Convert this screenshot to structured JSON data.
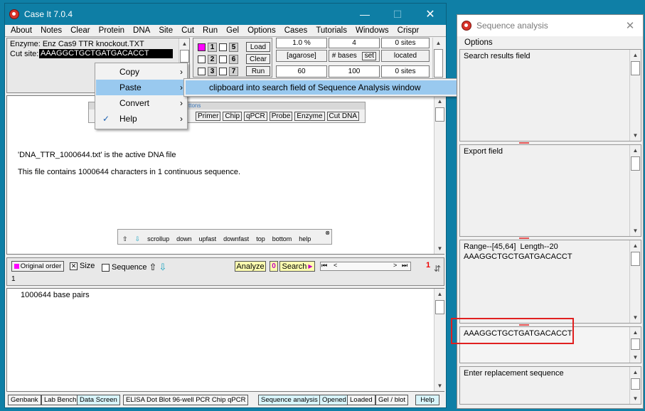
{
  "main_window": {
    "title": "Case It 7.0.4",
    "menu": [
      "About",
      "Notes",
      "Clear",
      "Protein",
      "DNA",
      "Site",
      "Cut",
      "Run",
      "Gel",
      "Options",
      "Cases",
      "Tutorials",
      "Windows",
      "Crispr"
    ],
    "enzyme_label": "Enzyme: Enz Cas9 TTR knockout.TXT",
    "cut_site_label": "Cut site:",
    "cut_site_value": "AAAGGCTGCTGATGACACCT",
    "slots": [
      "1",
      "5",
      "2",
      "6",
      "3",
      "7"
    ],
    "load_label": "Load",
    "clear_label": "Clear",
    "run_label": "Run",
    "agarose_pct": "1.0  %",
    "agarose_label": "[agarose]",
    "val_60": "60",
    "bases_value": "4",
    "bases_label": "# bases",
    "set_label": "set",
    "val_100": "100",
    "sites_top": "0  sites",
    "located_label": "located",
    "sites_bottom": "0  sites",
    "toolbar_buttons": [
      "Primer",
      "Chip",
      "qPCR",
      "Probe",
      "Enzyme",
      "Cut DNA"
    ],
    "toolbar_tail": "ttons",
    "content_line1": "'DNA_TTR_1000644.txt' is the active DNA file",
    "content_line2": "This file contains 1000644 characters in 1 continuous sequence.",
    "scroll_nav": [
      "scrollup",
      "down",
      "upfast",
      "downfast",
      "top",
      "bottom",
      "help"
    ],
    "original_order": "Original order",
    "size_label": "Size",
    "sequence_label": "Sequence",
    "analyze_label": "Analyze",
    "search_count": "0",
    "search_label": "Search",
    "position_indicator": "1",
    "row_number": "1",
    "base_pairs": "1000644 base pairs",
    "bottom_tabs": [
      "Genbank",
      "Lab Bench",
      "Data Screen",
      "ELISA  Dot Blot   96-well PCR   Chip  qPCR",
      "Sequence analysis",
      "Opened",
      "Loaded",
      "Gel / blot",
      "Help"
    ]
  },
  "context_menu": {
    "items": [
      "Copy",
      "Paste",
      "Convert",
      "Help"
    ],
    "submenu_item": "clipboard into search field of Sequence Analysis window"
  },
  "seq_window": {
    "title": "Sequence analysis",
    "menu": "Options",
    "search_results": "Search results field",
    "export_field": "Export field",
    "range_line1": "Range--[45,64]  Length--20",
    "range_line2": "AAAGGCTGCTGATGACACCT",
    "search_field_value": "AAAGGCTGCTGATGACACCT",
    "replacement_label": "Enter replacement sequence"
  },
  "colors": {
    "desktop": "#0f7fa6",
    "title_active": "#0e7ea5",
    "highlight": "#99c9ef",
    "red_box": "#e02020",
    "magenta": "#ff00ff"
  }
}
